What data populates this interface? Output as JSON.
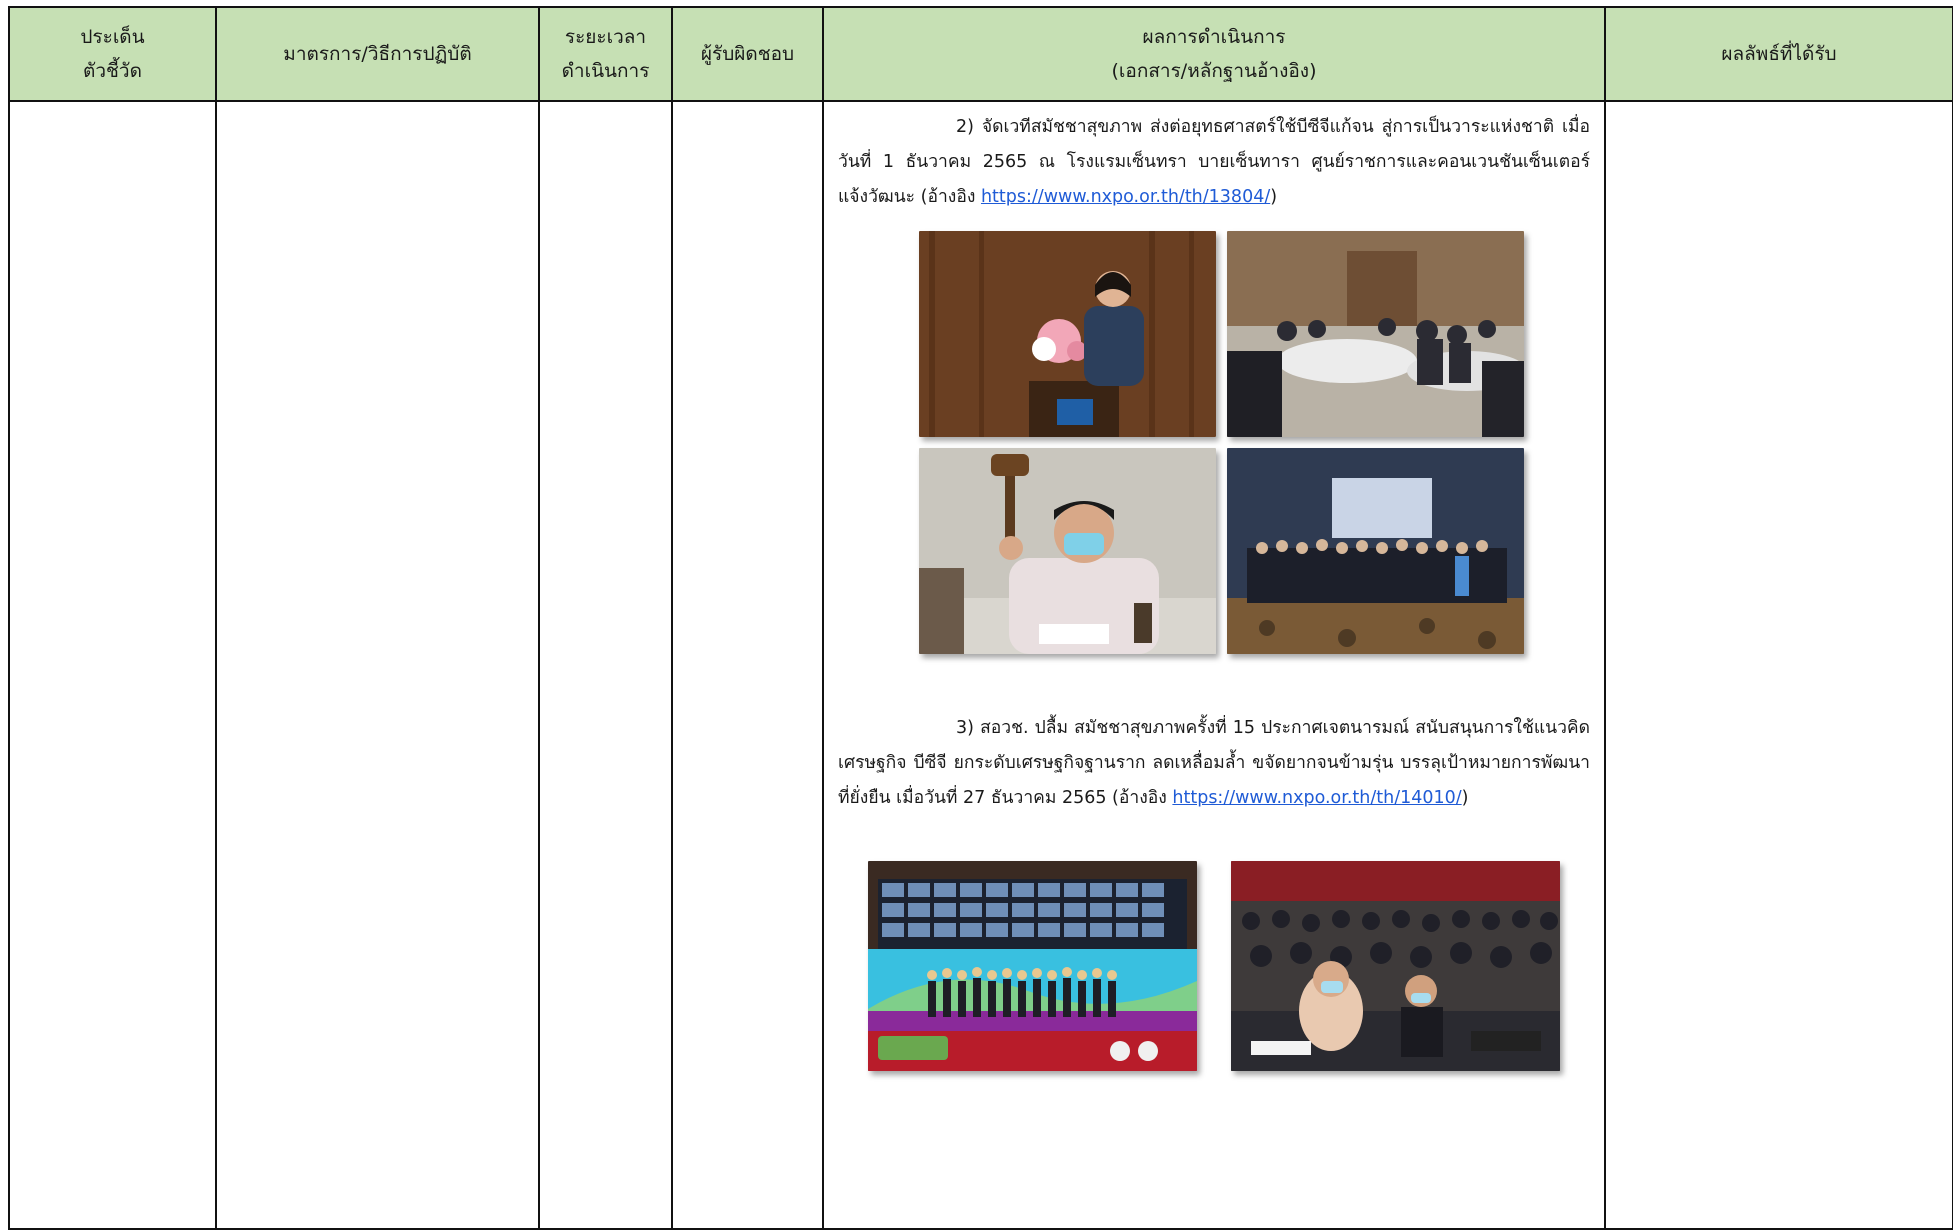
{
  "header": {
    "col1": [
      "ประเด็น",
      "ตัวชี้วัด"
    ],
    "col2": "มาตรการ/วิธีการปฏิบัติ",
    "col3": [
      "ระยะเวลา",
      "ดำเนินการ"
    ],
    "col4": "ผู้รับผิดชอบ",
    "col5": [
      "ผลการดำเนินการ",
      "(เอกสาร/หลักฐานอ้างอิง)"
    ],
    "col6": "ผลลัพธ์ที่ได้รับ"
  },
  "results": {
    "item2": {
      "text": "2) จัดเวทีสมัชชาสุขภาพ ส่งต่อยุทธศาสตร์ใช้บีซีจีแก้จน สู่การเป็นวาระแห่งชาติ เมื่อวันที่ 1 ธันวาคม 2565 ณ โรงแรมเซ็นทรา บายเซ็นทารา ศูนย์ราชการและคอนเวนชันเซ็นเตอร์ แจ้งวัฒนะ (อ้างอิง ",
      "link": "https://www.nxpo.or.th/th/13804/",
      "tail": ")"
    },
    "item3": {
      "text": "3) สอวช. ปลื้ม สมัชชาสุขภาพครั้งที่ 15 ประกาศเจตนารมณ์ สนับสนุนการใช้แนวคิดเศรษฐกิจ บีซีจี ยกระดับเศรษฐกิจฐานราก ลดเหลื่อมล้ำ ขจัดยากจนข้ามรุ่น บรรลุเป้าหมายการพัฒนาที่ยั่งยืน เมื่อวันที่ 27 ธันวาคม 2565 (อ้างอิง ",
      "link": "https://www.nxpo.or.th/th/14010/",
      "tail": ")"
    }
  },
  "colors": {
    "header_bg": "#c6e0b4",
    "border": "#111111",
    "link": "#1f5bd6"
  }
}
